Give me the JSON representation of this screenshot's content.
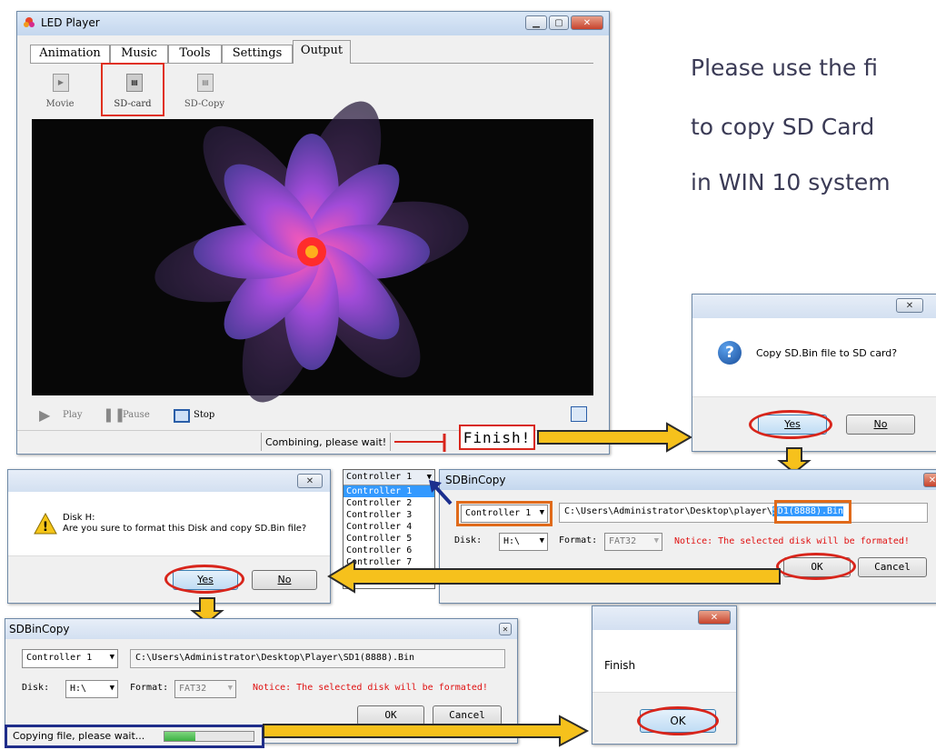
{
  "player": {
    "title": "LED Player",
    "tabs": [
      "Animation",
      "Music",
      "Tools",
      "Settings",
      "Output"
    ],
    "tools": [
      "Movie",
      "SD-card",
      "SD-Copy"
    ],
    "controls": {
      "play": "Play",
      "pause": "Pause",
      "stop": "Stop"
    },
    "status": "Combining, please wait!"
  },
  "finish_label": "Finish!",
  "instruction": {
    "line1": "Please use the fi",
    "line2": "to copy SD Card",
    "line3": "in WIN 10 system"
  },
  "confirm_copy": {
    "message": "Copy SD.Bin file to SD card?",
    "yes": "Yes",
    "no": "No"
  },
  "format_dialog": {
    "disk": "Disk H:",
    "message": "Are you sure to format this Disk and copy SD.Bin file?",
    "yes": "Yes",
    "no": "No"
  },
  "controller_dropdown": {
    "selected": "Controller 1",
    "options": [
      "Controller 1",
      "Controller 2",
      "Controller 3",
      "Controller 4",
      "Controller 5",
      "Controller 6",
      "Controller 7"
    ]
  },
  "sdbincopy": {
    "title": "SDBinCopy",
    "controller": "Controller 1",
    "path_prefix": "C:\\Users\\Administrator\\Desktop\\player\\",
    "path_highlight": "SD1(8888).Bin",
    "disk_label": "Disk:",
    "disk": "H:\\",
    "format_label": "Format:",
    "format": "FAT32",
    "notice": "Notice: The selected disk will be formated!",
    "ok": "OK",
    "cancel": "Cancel"
  },
  "sdbincopy_progress": {
    "title": "SDBinCopy",
    "controller": "Controller 1",
    "path": "C:\\Users\\Administrator\\Desktop\\Player\\SD1(8888).Bin",
    "disk_label": "Disk:",
    "disk": "H:\\",
    "format_label": "Format:",
    "format": "FAT32",
    "notice": "Notice: The selected disk will be formated!",
    "ok": "OK",
    "cancel": "Cancel",
    "status": "Copying file, please wait...",
    "progress": 0.35
  },
  "finish_dialog": {
    "message": "Finish",
    "ok": "OK"
  },
  "colors": {
    "accent_red": "#d8251b",
    "arrow_yellow": "#f6c11c",
    "notice_red": "#e01010",
    "progress_green": "#3cb043",
    "highlight_blue": "#3399ff"
  }
}
